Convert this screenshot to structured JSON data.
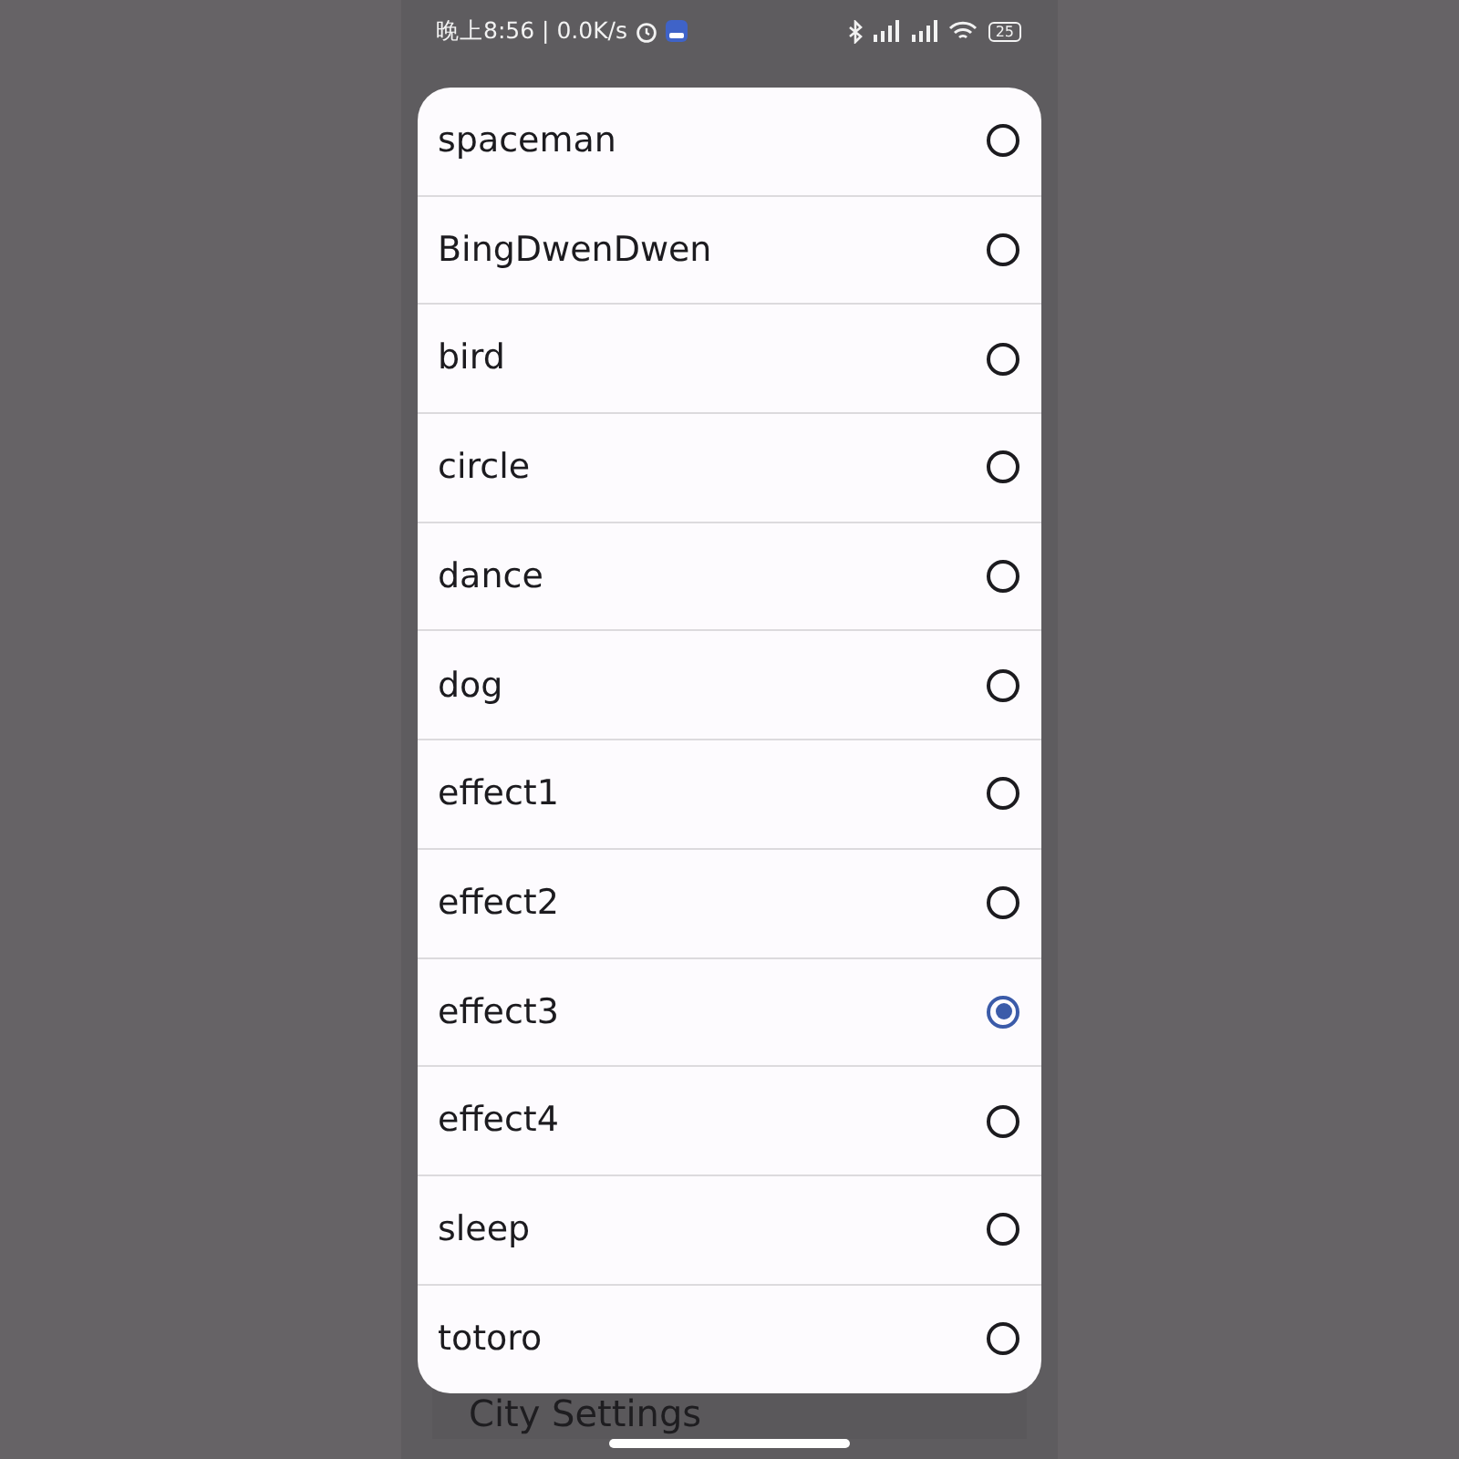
{
  "status_bar": {
    "time": "晚上8:56 | 0.0K/s",
    "battery": "25"
  },
  "background": {
    "card_title": "City Settings"
  },
  "dialog": {
    "options": [
      {
        "label": "spaceman",
        "selected": false
      },
      {
        "label": "BingDwenDwen",
        "selected": false
      },
      {
        "label": "bird",
        "selected": false
      },
      {
        "label": "circle",
        "selected": false
      },
      {
        "label": "dance",
        "selected": false
      },
      {
        "label": "dog",
        "selected": false
      },
      {
        "label": "effect1",
        "selected": false
      },
      {
        "label": "effect2",
        "selected": false
      },
      {
        "label": "effect3",
        "selected": true
      },
      {
        "label": "effect4",
        "selected": false
      },
      {
        "label": "sleep",
        "selected": false
      },
      {
        "label": "totoro",
        "selected": false
      }
    ]
  }
}
